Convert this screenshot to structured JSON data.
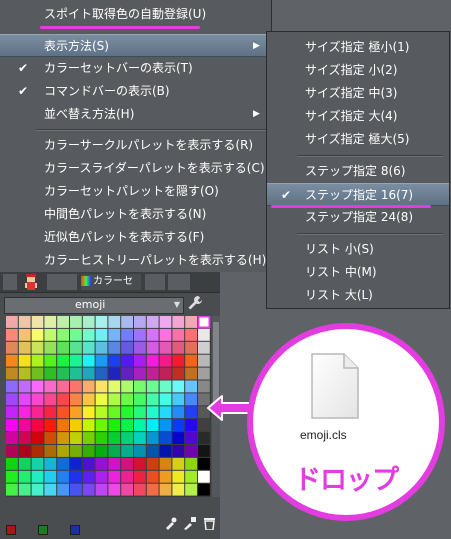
{
  "menu": {
    "items": [
      {
        "label": "スポイト取得色の自動登録(U)",
        "check": "",
        "arrow": ""
      },
      {
        "label": "表示方法(S)",
        "check": "",
        "arrow": "▶"
      },
      {
        "label": "カラーセットバーの表示(T)",
        "check": "✔",
        "arrow": ""
      },
      {
        "label": "コマンドバーの表示(B)",
        "check": "✔",
        "arrow": ""
      },
      {
        "label": "並べ替え方法(H)",
        "check": "",
        "arrow": "▶"
      },
      {
        "label": "カラーサークルパレットを表示する(R)",
        "check": "",
        "arrow": ""
      },
      {
        "label": "カラースライダーパレットを表示する(C)",
        "check": "",
        "arrow": ""
      },
      {
        "label": "カラーセットパレットを隠す(O)",
        "check": "",
        "arrow": ""
      },
      {
        "label": "中間色パレットを表示する(N)",
        "check": "",
        "arrow": ""
      },
      {
        "label": "近似色パレットを表示する(F)",
        "check": "",
        "arrow": ""
      },
      {
        "label": "カラーヒストリーパレットを表示する(H)",
        "check": "",
        "arrow": ""
      }
    ]
  },
  "submenu": {
    "items": [
      {
        "label": "サイズ指定 極小(1)",
        "check": ""
      },
      {
        "label": "サイズ指定 小(2)",
        "check": ""
      },
      {
        "label": "サイズ指定 中(3)",
        "check": ""
      },
      {
        "label": "サイズ指定 大(4)",
        "check": ""
      },
      {
        "label": "サイズ指定 極大(5)",
        "check": ""
      },
      {
        "label": "ステップ指定 8(6)",
        "check": ""
      },
      {
        "label": "ステップ指定 16(7)",
        "check": "✔"
      },
      {
        "label": "ステップ指定 24(8)",
        "check": ""
      },
      {
        "label": "リスト 小(S)",
        "check": ""
      },
      {
        "label": "リスト 中(M)",
        "check": ""
      },
      {
        "label": "リスト 大(L)",
        "check": ""
      }
    ]
  },
  "panel": {
    "tab_label": "カラーセ",
    "colorset_name": "emoji",
    "dropdown_arrow": "▼"
  },
  "callout": {
    "file_name": "emoji.cls",
    "drop_label": "ドロップ"
  },
  "colors": {
    "accent": "#e33ce0",
    "menu_bg": "#575b5f",
    "highlight": "#6f8296"
  },
  "icons": [
    "checkmark-icon",
    "submenu-arrow-icon",
    "wrench-icon",
    "file-icon",
    "drag-arrow-icon",
    "trash-icon",
    "eyedropper-icon"
  ]
}
